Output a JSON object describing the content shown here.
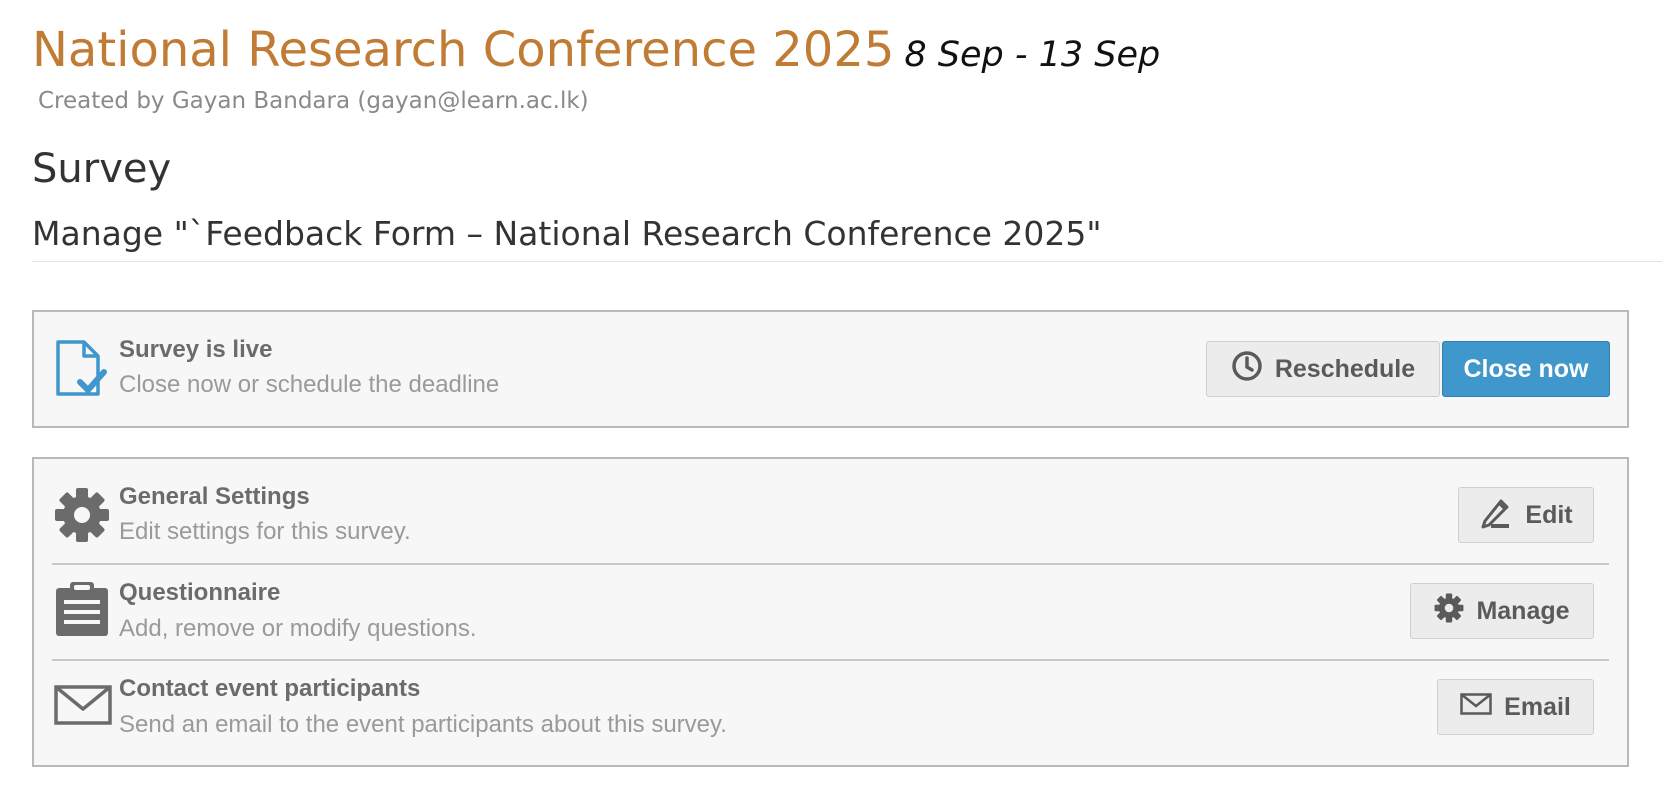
{
  "event": {
    "title": "National Research Conference 2025",
    "dates": "8 Sep - 13 Sep",
    "created_by": "Created by Gayan Bandara (gayan@learn.ac.lk)"
  },
  "page": {
    "heading": "Survey",
    "subheading": "Manage \"`Feedback Form – National Research Conference 2025\""
  },
  "status": {
    "icon": "document-check-icon",
    "title": "Survey is live",
    "description": "Close now or schedule the deadline",
    "reschedule_label": "Reschedule",
    "reschedule_icon": "clock-icon",
    "close_label": "Close now"
  },
  "actions": [
    {
      "icon": "gear-icon",
      "title": "General Settings",
      "description": "Edit settings for this survey.",
      "button_label": "Edit",
      "button_icon": "pencil-icon"
    },
    {
      "icon": "clipboard-icon",
      "title": "Questionnaire",
      "description": "Add, remove or modify questions.",
      "button_label": "Manage",
      "button_icon": "gear-icon"
    },
    {
      "icon": "envelope-icon",
      "title": "Contact event participants",
      "description": "Send an email to the event participants about this survey.",
      "button_label": "Email",
      "button_icon": "envelope-icon"
    }
  ],
  "colors": {
    "title": "#c07c35",
    "primary_button": "#3f97cc",
    "status_icon": "#3f97cc",
    "panel_bg": "#f7f7f7"
  }
}
